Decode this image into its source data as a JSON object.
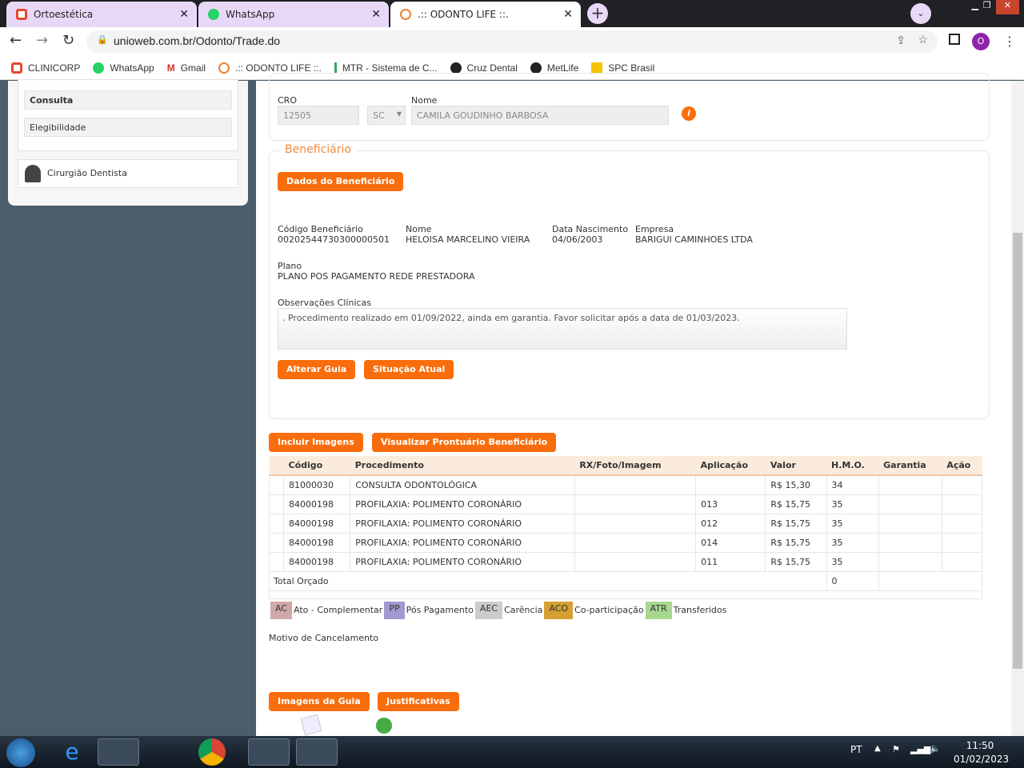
{
  "browser": {
    "tabs": [
      {
        "label": "Ortoestética"
      },
      {
        "label": "WhatsApp"
      },
      {
        "label": ".:: ODONTO LIFE ::."
      }
    ],
    "url": "unioweb.com.br/Odonto/Trade.do",
    "profile": "O",
    "bookmarks": [
      "CLINICORP",
      "WhatsApp",
      "Gmail",
      ".:: ODONTO LIFE ::.",
      "MTR - Sistema de C...",
      "Cruz Dental",
      "MetLife",
      "SPC Brasil"
    ]
  },
  "sidebar": {
    "items": [
      "Consulta",
      "Elegibilidade"
    ],
    "user": "Cirurgião Dentista"
  },
  "dentist": {
    "cro_label": "CRO",
    "cro": "12505",
    "uf": "SC",
    "name_label": "Nome",
    "name": "CAMILA GOUDINHO BARBOSA"
  },
  "beneficiary": {
    "legend": "Beneficiário",
    "data_button": "Dados do Beneficiário",
    "code_label": "Código Beneficiário",
    "code": "00202544730300000501",
    "name_label": "Nome",
    "name": "HELOISA MARCELINO VIEIRA",
    "birth_label": "Data Nascimento",
    "birth": "04/06/2003",
    "company_label": "Empresa",
    "company": "BARIGUI CAMINHOES LTDA",
    "plan_label": "Plano",
    "plan": "PLANO POS PAGAMENTO REDE PRESTADORA",
    "obs_label": "Observações Clínicas",
    "obs": ". Procedimento realizado em 01/09/2022, ainda em garantia. Favor solicitar após a data de 01/03/2023.",
    "alter_button": "Alterar Guia",
    "status_button": "Situação Atual"
  },
  "actions": {
    "include_images": "Incluir Imagens",
    "view_record": "Visualizar Prontuário Beneficiário"
  },
  "table": {
    "headers": [
      "Código",
      "Procedimento",
      "RX/Foto/Imagem",
      "Aplicação",
      "Valor",
      "H.M.O.",
      "Garantia",
      "Ação"
    ],
    "rows": [
      [
        "81000030",
        "CONSULTA ODONTOLÓGICA",
        "",
        "",
        "R$ 15,30",
        "34",
        "",
        ""
      ],
      [
        "84000198",
        "PROFILAXIA: POLIMENTO CORONÁRIO",
        "",
        "013",
        "R$ 15,75",
        "35",
        "",
        ""
      ],
      [
        "84000198",
        "PROFILAXIA: POLIMENTO CORONÁRIO",
        "",
        "012",
        "R$ 15,75",
        "35",
        "",
        ""
      ],
      [
        "84000198",
        "PROFILAXIA: POLIMENTO CORONÁRIO",
        "",
        "014",
        "R$ 15,75",
        "35",
        "",
        ""
      ],
      [
        "84000198",
        "PROFILAXIA: POLIMENTO CORONÁRIO",
        "",
        "011",
        "R$ 15,75",
        "35",
        "",
        ""
      ]
    ],
    "total_label": "Total Orçado",
    "total_hmo": "0"
  },
  "legend": [
    {
      "code": "AC",
      "label": "Ato - Complementar",
      "color": "#d0a8a8"
    },
    {
      "code": "PP",
      "label": "Pós Pagamento",
      "color": "#a09ad0"
    },
    {
      "code": "AEC",
      "label": "Carência",
      "color": "#cccccc"
    },
    {
      "code": "ACO",
      "label": "Co-participação",
      "color": "#d4a032"
    },
    {
      "code": "ATR",
      "label": "Transferidos",
      "color": "#a8d890"
    }
  ],
  "cancel_label": "Motivo de Cancelamento",
  "bottom": {
    "images_button": "Imagens da Guia",
    "justify_button": "Justificativas"
  },
  "taskbar": {
    "lang": "PT",
    "time": "11:50",
    "date": "01/02/2023"
  }
}
